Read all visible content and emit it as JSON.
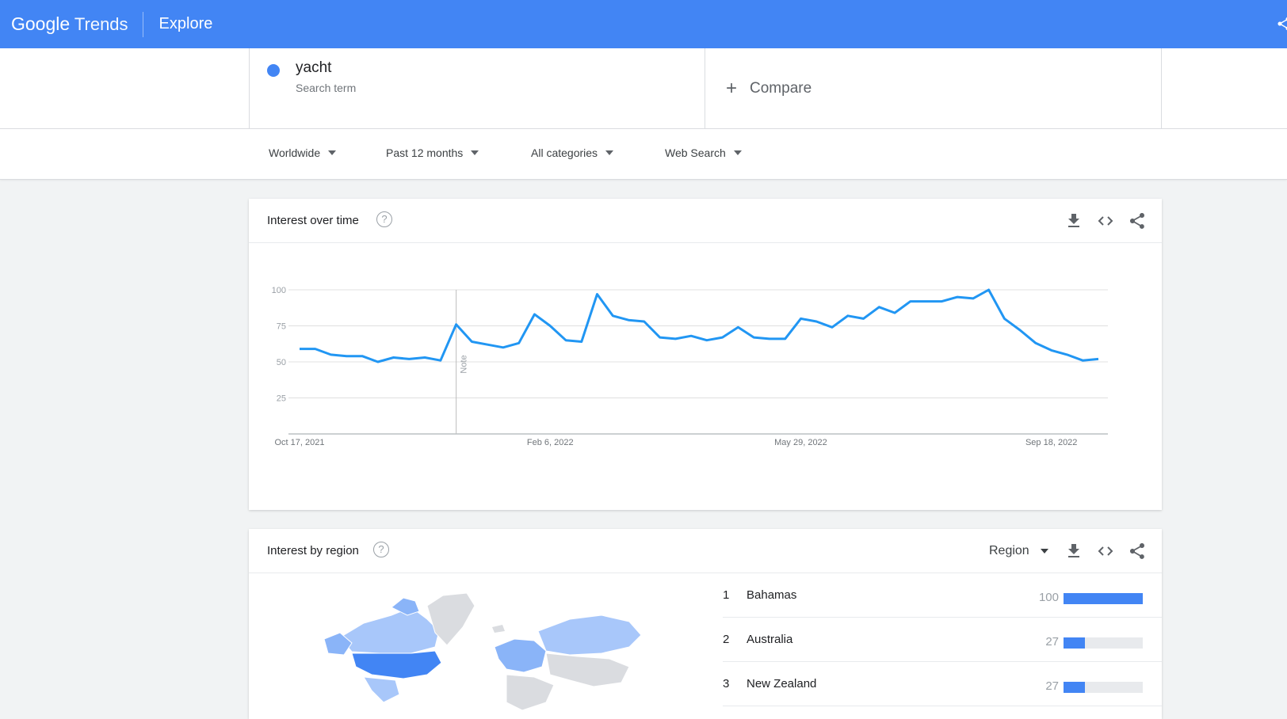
{
  "header": {
    "brand_google": "Google",
    "brand_trends": "Trends",
    "page": "Explore"
  },
  "search": {
    "term": "yacht",
    "term_type": "Search term",
    "compare_label": "Compare",
    "term_color": "#4285f4"
  },
  "filters": [
    {
      "label": "Worldwide"
    },
    {
      "label": "Past 12 months"
    },
    {
      "label": "All categories"
    },
    {
      "label": "Web Search"
    }
  ],
  "interest_over_time": {
    "title": "Interest over time",
    "note_label": "Note"
  },
  "chart_data": {
    "type": "line",
    "x_tick_labels": [
      "Oct 17, 2021",
      "Feb 6, 2022",
      "May 29, 2022",
      "Sep 18, 2022"
    ],
    "y_tick_labels": [
      "100",
      "75",
      "50",
      "25"
    ],
    "ylim": [
      0,
      100
    ],
    "grid": true,
    "series": [
      {
        "color": "#2196f3",
        "values": [
          59,
          59,
          55,
          54,
          54,
          50,
          53,
          52,
          53,
          51,
          76,
          64,
          62,
          60,
          63,
          83,
          75,
          65,
          64,
          97,
          82,
          79,
          78,
          67,
          66,
          68,
          65,
          67,
          74,
          67,
          66,
          66,
          80,
          78,
          74,
          82,
          80,
          88,
          84,
          92,
          92,
          92,
          95,
          94,
          100,
          80,
          72,
          63,
          58,
          55,
          51,
          52
        ]
      }
    ]
  },
  "interest_by_region": {
    "title": "Interest by region",
    "resolution_label": "Region",
    "rows": [
      {
        "rank": "1",
        "name": "Bahamas",
        "value": "100",
        "fraction": 1.0
      },
      {
        "rank": "2",
        "name": "Australia",
        "value": "27",
        "fraction": 0.27
      },
      {
        "rank": "3",
        "name": "New Zealand",
        "value": "27",
        "fraction": 0.27
      }
    ],
    "bar_color": "#4285f4"
  },
  "icons": {
    "help": "help-icon",
    "download": "download-icon",
    "embed": "embed-icon",
    "share": "share-icon",
    "plus": "plus-icon"
  }
}
